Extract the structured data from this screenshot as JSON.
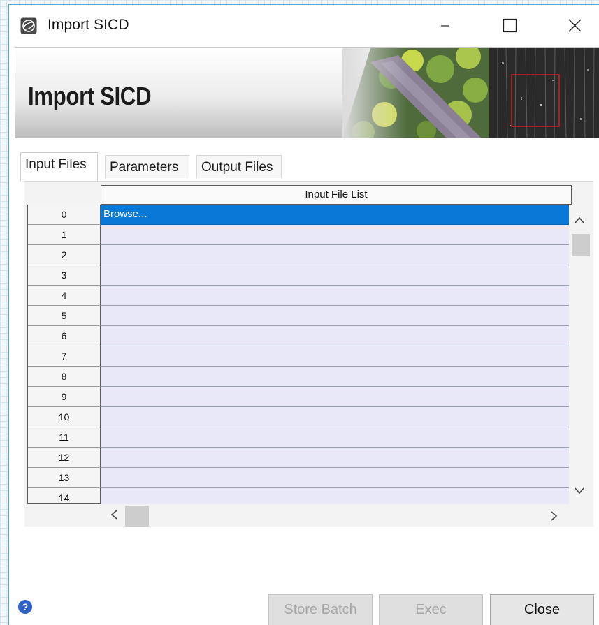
{
  "window": {
    "title": "Import SICD",
    "icon": "app-globe-icon",
    "controls": {
      "minimize": "minimize-icon",
      "maximize": "maximize-icon",
      "close": "close-icon"
    }
  },
  "banner": {
    "title": "Import SICD",
    "image": "aerial-sar-image"
  },
  "tabs": [
    {
      "label": "Input Files",
      "active": true
    },
    {
      "label": "Parameters",
      "active": false
    },
    {
      "label": "Output Files",
      "active": false
    }
  ],
  "table": {
    "column_header": "Input File List",
    "rows": [
      {
        "index": "0",
        "value": "Browse...",
        "selected": true
      },
      {
        "index": "1",
        "value": ""
      },
      {
        "index": "2",
        "value": ""
      },
      {
        "index": "3",
        "value": ""
      },
      {
        "index": "4",
        "value": ""
      },
      {
        "index": "5",
        "value": ""
      },
      {
        "index": "6",
        "value": ""
      },
      {
        "index": "7",
        "value": ""
      },
      {
        "index": "8",
        "value": ""
      },
      {
        "index": "9",
        "value": ""
      },
      {
        "index": "10",
        "value": ""
      },
      {
        "index": "11",
        "value": ""
      },
      {
        "index": "12",
        "value": ""
      },
      {
        "index": "13",
        "value": ""
      },
      {
        "index": "14",
        "value": ""
      }
    ]
  },
  "buttons": {
    "store_batch": "Store Batch",
    "exec": "Exec",
    "close": "Close"
  },
  "help": {
    "icon": "help-icon"
  },
  "colors": {
    "selection": "#0a78d6",
    "cell_background": "#e8e8f8",
    "window_border": "#53a7d6"
  }
}
